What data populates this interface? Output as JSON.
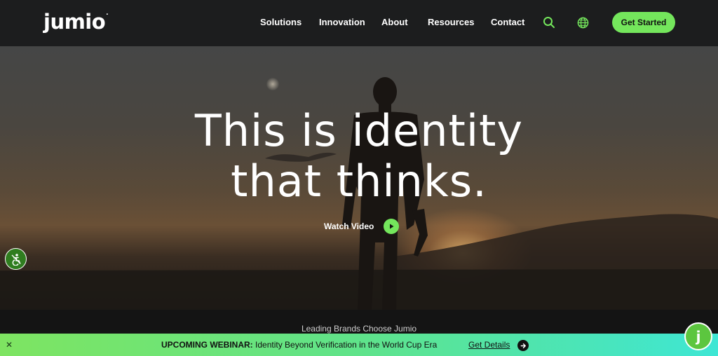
{
  "brand": {
    "logo_text": "jumio",
    "logo_mark": "."
  },
  "nav": {
    "items": [
      {
        "label": "Solutions"
      },
      {
        "label": "Innovation"
      },
      {
        "label": "About"
      },
      {
        "label": "Resources"
      },
      {
        "label": "Contact"
      }
    ],
    "search_icon": "search-icon",
    "language_icon": "globe-icon",
    "cta_label": "Get Started"
  },
  "hero": {
    "title_line1": "This is identity",
    "title_line2": "that thinks.",
    "watch_label": "Watch Video",
    "play_icon": "play-icon"
  },
  "brands": {
    "label": "Leading Brands Choose Jumio"
  },
  "banner": {
    "close_symbol": "✕",
    "lead": "UPCOMING WEBINAR:",
    "text": "Identity Beyond Verification in the World Cup Era",
    "link_label": "Get Details",
    "arrow_icon": "arrow-right-icon"
  },
  "chat": {
    "label": "j"
  },
  "colors": {
    "accent": "#74e65c",
    "nav_bg": "#1c1d1e",
    "banner_start": "#7ee461",
    "banner_end": "#3ee6d4"
  }
}
